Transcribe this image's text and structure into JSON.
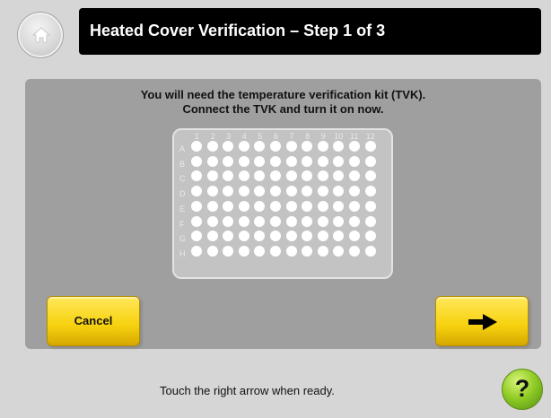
{
  "header": {
    "title": "Heated Cover Verification – Step 1 of 3",
    "home_icon": "home-icon"
  },
  "main": {
    "instructions": [
      "You will need the temperature verification kit (TVK).",
      "Connect the TVK and turn it on now."
    ],
    "plate": {
      "columns": [
        "1",
        "2",
        "3",
        "4",
        "5",
        "6",
        "7",
        "8",
        "9",
        "10",
        "11",
        "12"
      ],
      "rows": [
        "A",
        "B",
        "C",
        "D",
        "E",
        "F",
        "G",
        "H"
      ]
    }
  },
  "actions": {
    "cancel_label": "Cancel",
    "next_icon": "right-arrow-icon"
  },
  "footer": {
    "instruction": "Touch the right arrow when ready.",
    "help_label": "?"
  },
  "colors": {
    "background": "#d6d6d6",
    "panel": "#9f9f9f",
    "title_bar": "#000000",
    "title_text": "#ffffff",
    "button_yellow": "#f7d20f",
    "help_green": "#93cd26",
    "plate": "#c3c3c3",
    "well": "#ffffff"
  }
}
